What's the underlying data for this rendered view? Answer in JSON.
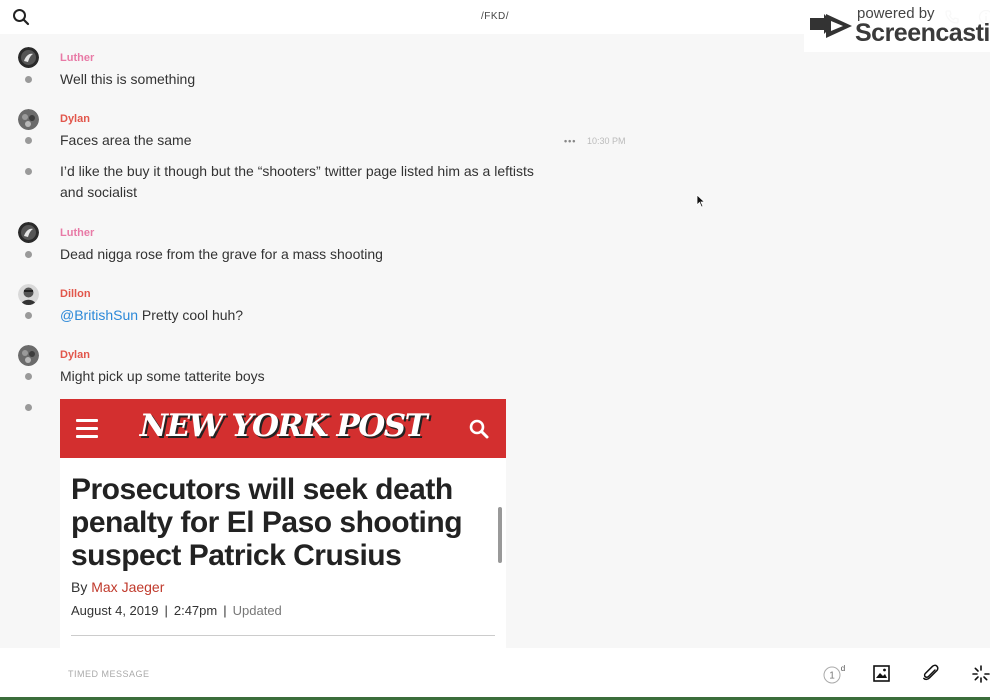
{
  "header": {
    "title": "/FKD/",
    "search_icon": "search-icon",
    "phone_icon": "phone-icon",
    "info_icon": "info-icon"
  },
  "watermark": {
    "small": "powered by",
    "big": "Screencastify"
  },
  "messages": [
    {
      "author": "Luther",
      "text": "Well this is something"
    },
    {
      "author": "Dylan",
      "text": "Faces area the same",
      "time": "10:30 PM"
    },
    {
      "text": "I’d like the buy it though but the “shooters” twitter page listed him as a leftists and socialist"
    },
    {
      "author": "Luther",
      "text": "Dead nigga rose from the grave for a mass shooting"
    },
    {
      "author": "Dillon",
      "mention": "@BritishSun",
      "text": " Pretty cool huh?"
    },
    {
      "author": "Dylan",
      "text": "Might pick up some tatterite boys"
    }
  ],
  "article": {
    "logo": "NEW YORK POST",
    "headline": "Prosecutors will seek death penalty for El Paso shooting suspect Patrick Crusius",
    "by": "By ",
    "author": "Max Jaeger",
    "date": "August 4, 2019",
    "time": "2:47pm",
    "updated": "Updated"
  },
  "composer": {
    "placeholder": "TIMED MESSAGE",
    "timer_value": "1",
    "timer_unit": "d"
  },
  "colors": {
    "author_pink": "#e87aa6",
    "author_red": "#e2564b",
    "mention": "#2b88d8",
    "nyp_red": "#d32f2f"
  }
}
